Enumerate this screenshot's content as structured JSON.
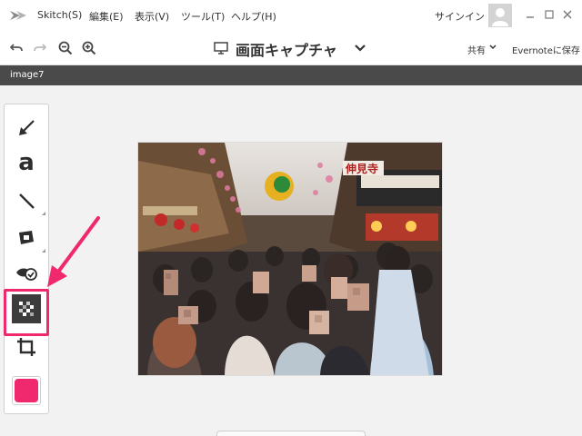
{
  "app": {
    "menu": [
      "Skitch(S)",
      "編集(E)",
      "表示(V)",
      "ツール(T)",
      "ヘルプ(H)"
    ],
    "signin_label": "サインイン"
  },
  "toolbar": {
    "title": "画面キャプチャ",
    "share_label": "共有",
    "save_evernote_label": "Evernoteに保存"
  },
  "file": {
    "name": "image7"
  },
  "tools": [
    {
      "name": "arrow-tool",
      "icon": "arrow-down-left-icon"
    },
    {
      "name": "text-tool",
      "icon": "text-a-icon",
      "glyph": "a"
    },
    {
      "name": "line-tool",
      "icon": "line-icon"
    },
    {
      "name": "stamp-tool",
      "icon": "stamp-icon"
    },
    {
      "name": "highlighter-tool",
      "icon": "eye-check-icon"
    },
    {
      "name": "pixelate-tool",
      "icon": "pixelate-icon",
      "selected": true
    },
    {
      "name": "crop-tool",
      "icon": "crop-icon"
    }
  ],
  "colors": {
    "accent": "#f0286e",
    "filebar": "#4a4a4a",
    "selected_tool_bg": "#3c3c3c",
    "current_color": "#f0286e"
  },
  "photo": {
    "sign_text": "伸見寺"
  }
}
